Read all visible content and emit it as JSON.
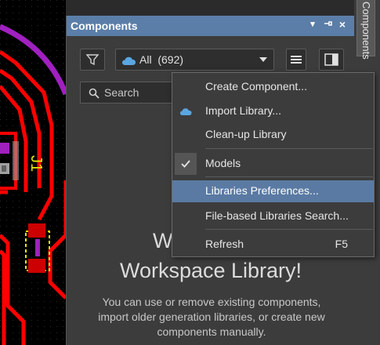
{
  "panel": {
    "title": "Components",
    "side_tab_label": "Components",
    "header_icons": {
      "menu": "▾",
      "pin": "⊣",
      "close": "×"
    }
  },
  "toolbar": {
    "dropdown_value": "All  (692)",
    "search_placeholder": "Search"
  },
  "welcome": {
    "headline_start": "W",
    "headline_line2": "Workspace Library!",
    "body": "You can use or remove existing components, import older generation libraries, or create new components manually."
  },
  "context_menu": {
    "items": [
      {
        "label": "Create Component..."
      },
      {
        "label": "Import Library..."
      },
      {
        "label": "Clean-up Library"
      },
      {
        "label": "Models",
        "checked": true
      },
      {
        "label": "Libraries Preferences...",
        "highlighted": true
      },
      {
        "label": "File-based Libraries Search..."
      },
      {
        "label": "Refresh",
        "shortcut": "F5"
      }
    ]
  },
  "pcb": {
    "designator": "J1"
  },
  "colors": {
    "header_bg": "#5b7ea8",
    "highlight": "#5a7aa3",
    "cloud_icon": "#5aa6e0",
    "trace_red": "#ff0000",
    "trace_purple": "#a020c0",
    "silkscreen_yellow": "#e6e600"
  }
}
